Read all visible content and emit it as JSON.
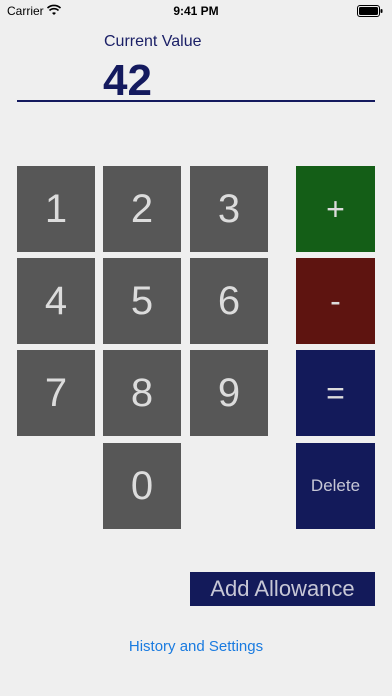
{
  "status_bar": {
    "carrier": "Carrier",
    "time": "9:41 PM"
  },
  "display": {
    "label": "Current Value",
    "value": "42"
  },
  "keypad": {
    "k1": "1",
    "k2": "2",
    "k3": "3",
    "k4": "4",
    "k5": "5",
    "k6": "6",
    "k7": "7",
    "k8": "8",
    "k9": "9",
    "k0": "0"
  },
  "operators": {
    "plus": "+",
    "minus": "-",
    "equals": "=",
    "delete": "Delete"
  },
  "actions": {
    "add_allowance": "Add Allowance",
    "history_settings": "History and Settings"
  },
  "colors": {
    "background": "#efefef",
    "key": "#575757",
    "plus": "#145e17",
    "minus": "#5e1410",
    "navy": "#131a5a",
    "link": "#1a7be0"
  },
  "icons": [
    "wifi-icon",
    "battery-icon"
  ]
}
